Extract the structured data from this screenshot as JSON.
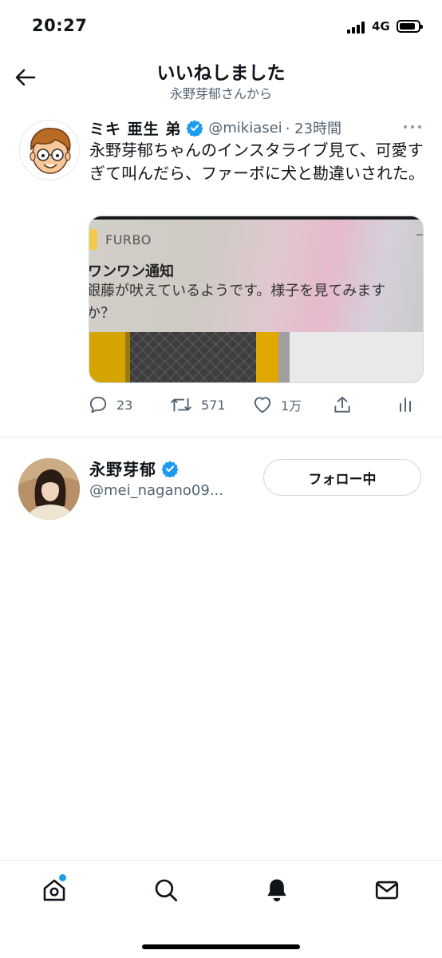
{
  "status_bar": {
    "time": "20:27",
    "network": "4G"
  },
  "header": {
    "title": "いいねしました",
    "subtitle": "永野芽郁さんから"
  },
  "tweet": {
    "author_name": "ミキ 亜生 弟",
    "handle": "@mikiasei",
    "time": "· 23時間",
    "text": "永野芽郁ちゃんのインスタライブ見て、可愛すぎて叫んだら、ファーボに犬と勘違いされた。",
    "media": {
      "app_label": "FURBO",
      "notification_title": "ワンワン通知",
      "notification_body": "銀藤が吠えているようです。様子を見てみますか？"
    },
    "actions": {
      "replies": "23",
      "retweets": "571",
      "likes": "1万"
    }
  },
  "user_row": {
    "name": "永野芽郁",
    "handle": "@mei_nagano09...",
    "follow_label": "フォロー中"
  },
  "colors": {
    "accent": "#1d9bf0",
    "secondary_text": "#536471",
    "border": "#cfd9de"
  },
  "icons": {
    "back": "arrow-left-icon",
    "verified": "verified-badge-icon",
    "more": "more-dots-icon",
    "reply": "reply-icon",
    "retweet": "retweet-icon",
    "like": "heart-icon",
    "share": "share-icon",
    "analytics": "analytics-icon",
    "home": "home-icon",
    "search": "search-icon",
    "notifications": "bell-icon",
    "messages": "mail-icon"
  }
}
